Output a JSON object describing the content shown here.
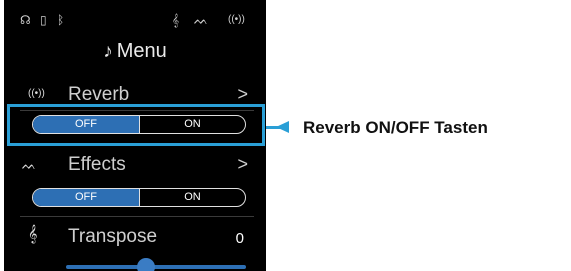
{
  "status_bar": {
    "icons": [
      "headphones-icon",
      "usb-drive-icon",
      "bluetooth-icon",
      "transpose-icon",
      "effects-icon",
      "reverb-icon"
    ],
    "glyphs": [
      "☊",
      "▯",
      "ᛒ",
      "𝄞",
      "ᨓ",
      "((•))"
    ]
  },
  "menu": {
    "title": "Menu",
    "title_icon": "♪"
  },
  "reverb": {
    "label": "Reverb",
    "icon_glyph": "((•))",
    "chevron": ">",
    "off_label": "OFF",
    "on_label": "ON",
    "selected": "OFF"
  },
  "effects": {
    "label": "Effects",
    "icon_glyph": "ᨓ",
    "chevron": ">",
    "off_label": "OFF",
    "on_label": "ON",
    "selected": "OFF"
  },
  "transpose": {
    "label": "Transpose",
    "icon_glyph": "𝄞",
    "value": "0"
  },
  "callout": {
    "text": "Reverb ON/OFF Tasten"
  },
  "colors": {
    "accent": "#2a9fd6",
    "toggle_active": "#2d6fb4",
    "screen_bg": "#000000"
  }
}
